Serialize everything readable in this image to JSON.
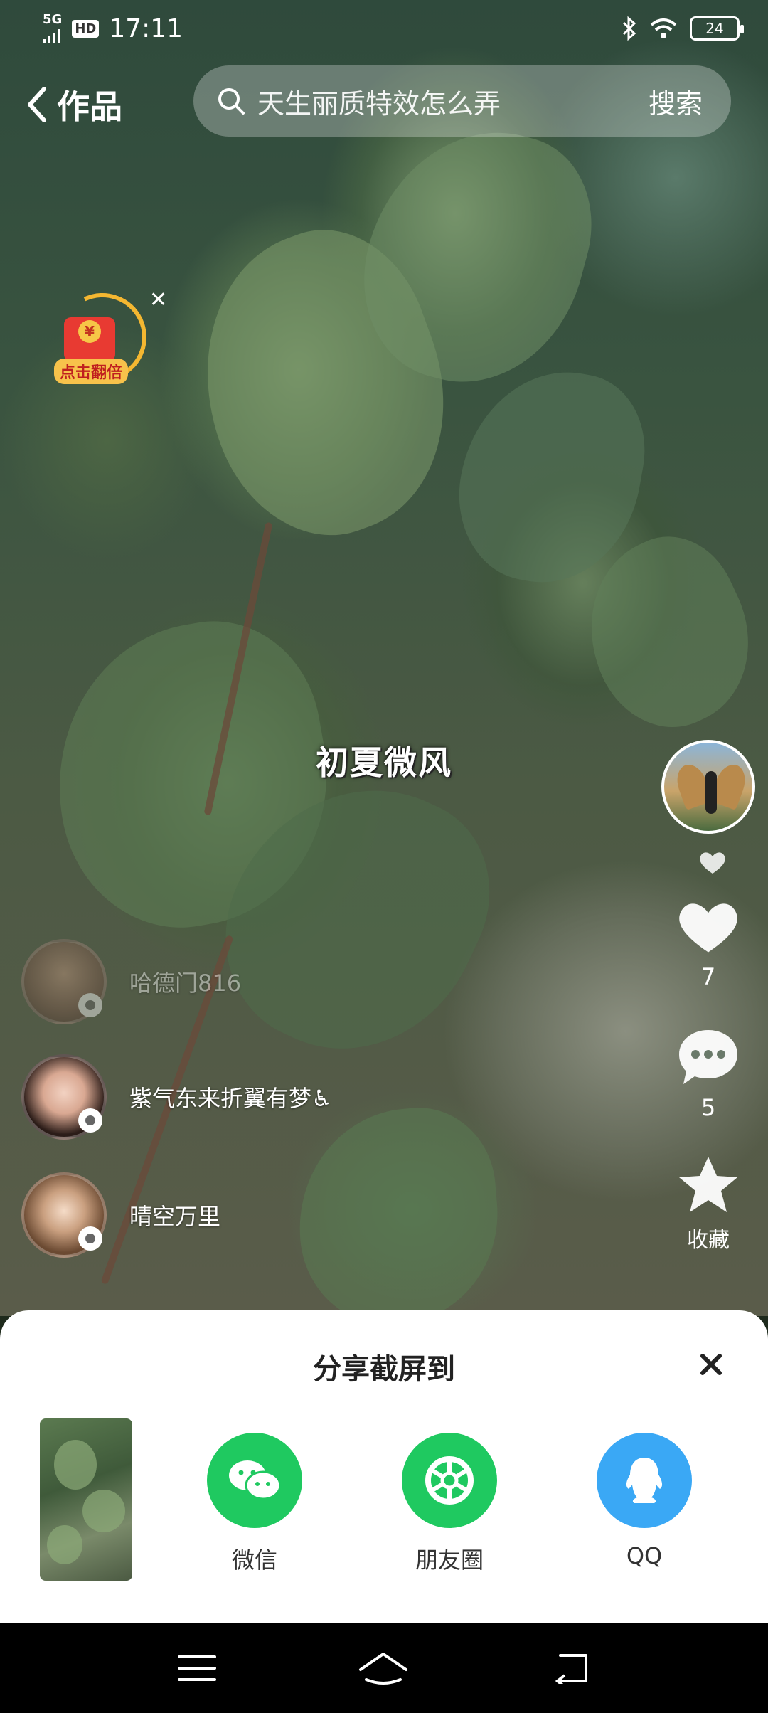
{
  "status_bar": {
    "network": "5G",
    "hd": "HD",
    "time": "17:11",
    "battery": "24"
  },
  "top_nav": {
    "back_title": "作品",
    "search_placeholder": "天生丽质特效怎么弄",
    "search_button": "搜索"
  },
  "red_packet": {
    "label": "点击翻倍",
    "coin": "¥"
  },
  "video": {
    "caption": "初夏微风"
  },
  "right_rail": {
    "like_count": "7",
    "comment_count": "5",
    "favorite_label": "收藏"
  },
  "viewers": [
    {
      "name": "哈德门816"
    },
    {
      "name": "紫气东来折翼有梦♿"
    },
    {
      "name": "晴空万里"
    }
  ],
  "share_sheet": {
    "title": "分享截屏到",
    "options": [
      {
        "label": "微信",
        "icon": "wechat-icon",
        "color": "#1fc960"
      },
      {
        "label": "朋友圈",
        "icon": "moments-icon",
        "color": "#1fc960"
      },
      {
        "label": "QQ",
        "icon": "qq-icon",
        "color": "#3aa8f5"
      }
    ]
  }
}
